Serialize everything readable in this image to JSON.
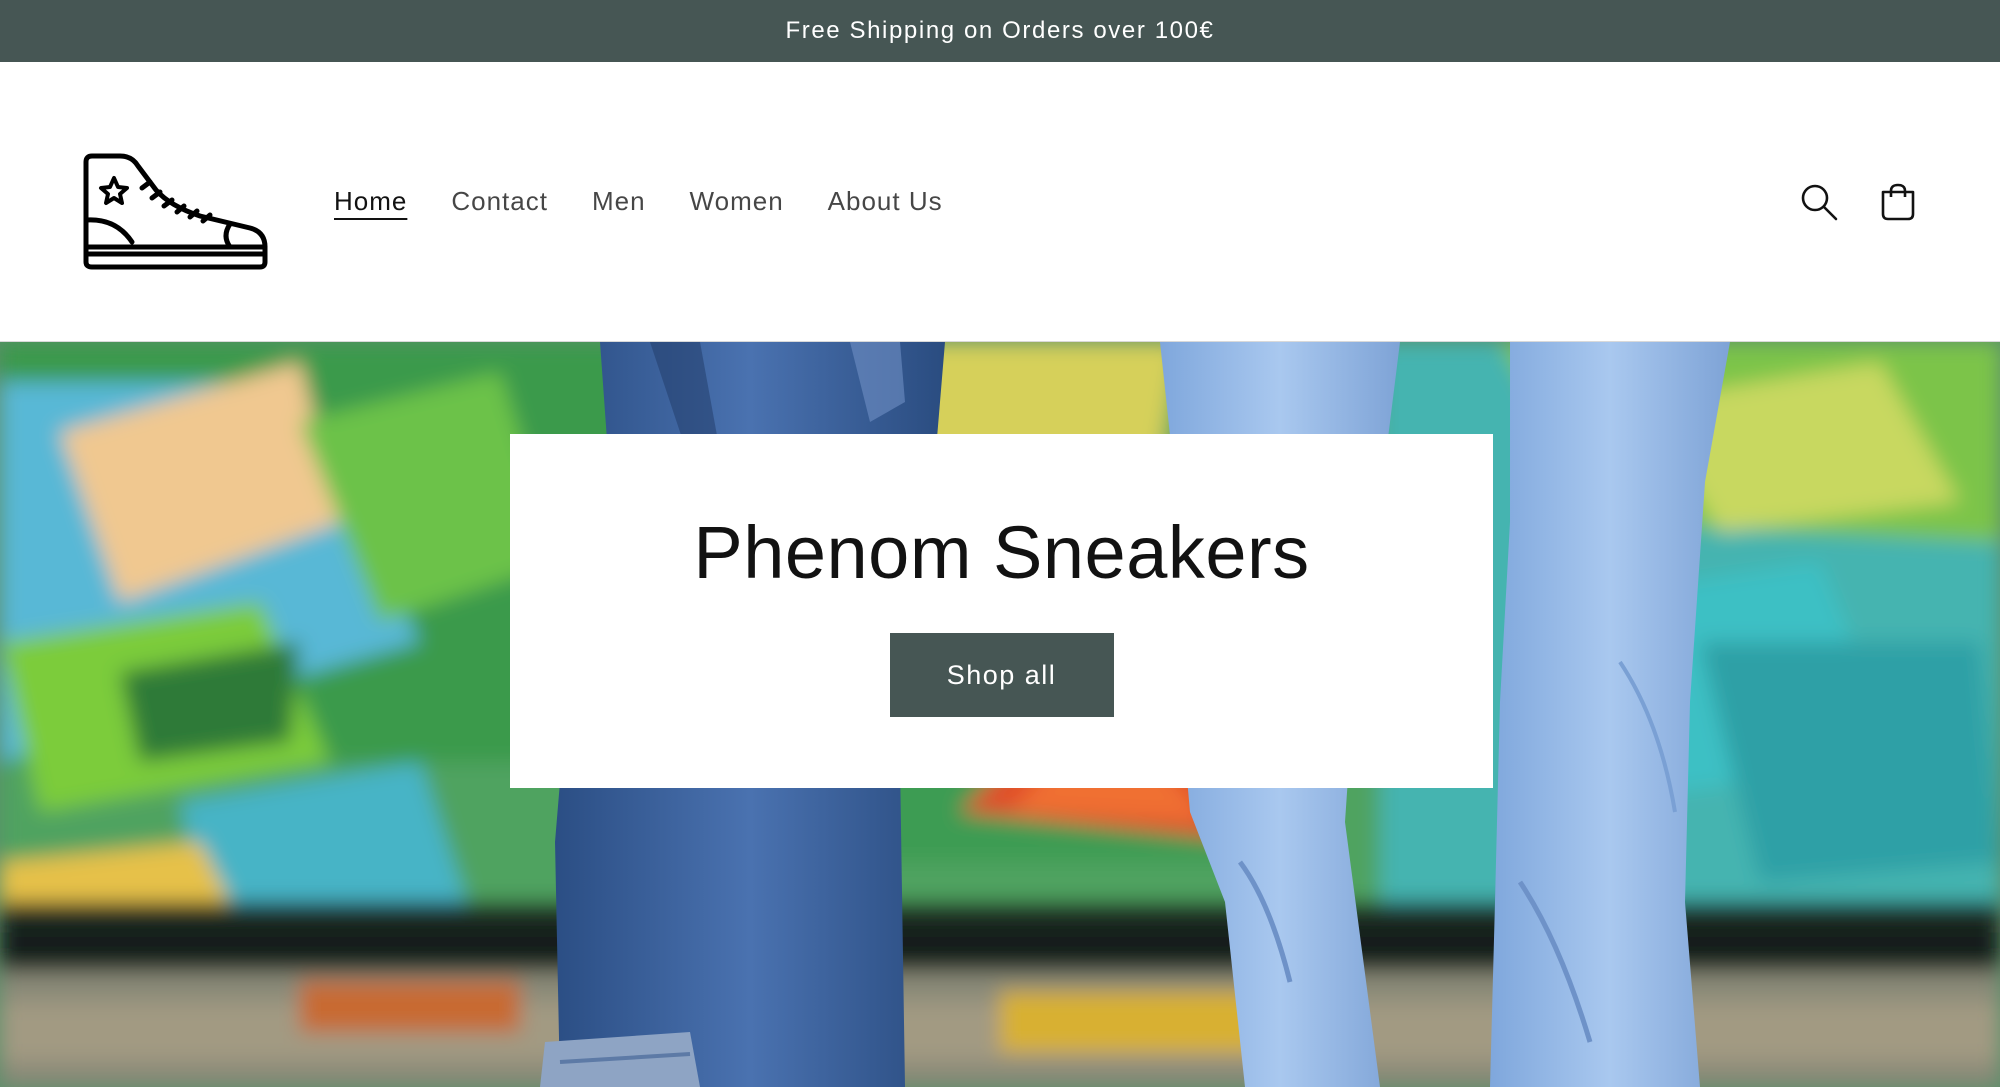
{
  "announcement": {
    "text": "Free Shipping on Orders over 100€",
    "background": "#465654"
  },
  "header": {
    "logo_icon": "sneaker-icon",
    "nav": [
      {
        "label": "Home",
        "active": true
      },
      {
        "label": "Contact",
        "active": false
      },
      {
        "label": "Men",
        "active": false
      },
      {
        "label": "Women",
        "active": false
      },
      {
        "label": "About Us",
        "active": false
      }
    ],
    "icons": [
      "search-icon",
      "cart-icon"
    ]
  },
  "hero": {
    "title": "Phenom Sneakers",
    "button_label": "Shop all",
    "button_color": "#465654"
  }
}
